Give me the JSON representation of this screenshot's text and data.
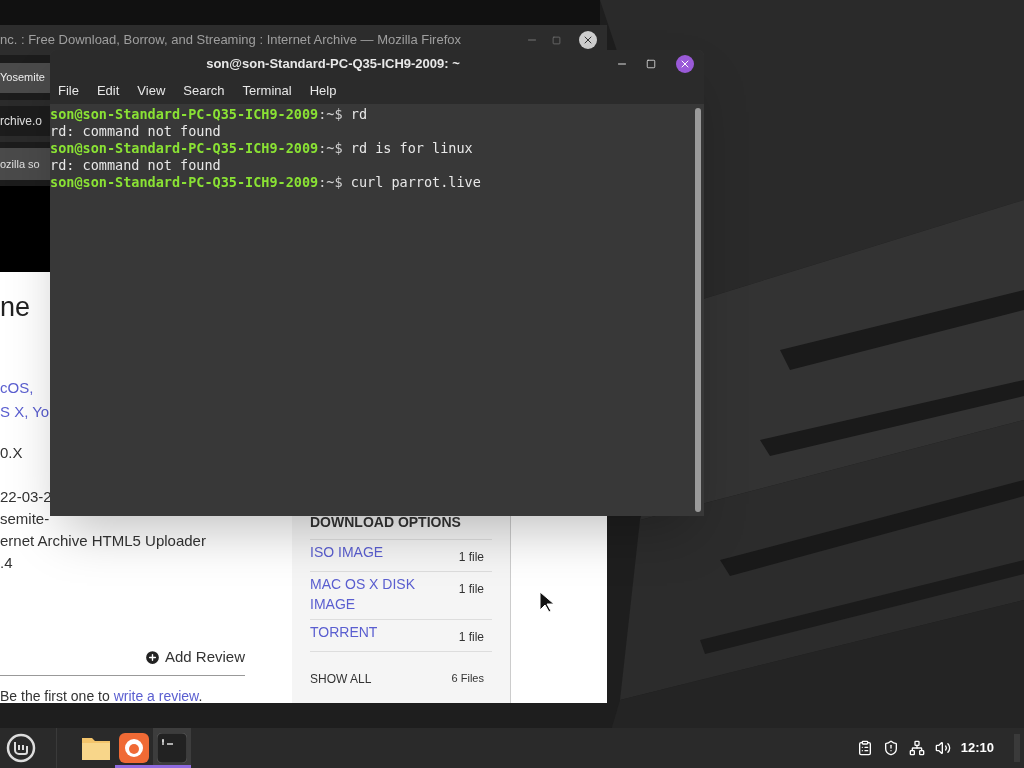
{
  "browser_window": {
    "title": "nc. : Free Download, Borrow, and Streaming : Internet Archive — Mozilla Firefox",
    "tab": "Yosemite",
    "address": "rchive.o",
    "bookmark": "ozilla so",
    "page": {
      "heading": "ne",
      "details": [
        {
          "kind": "link",
          "text": "cOS,"
        },
        {
          "kind": "link",
          "text": "S X, Yo"
        },
        {
          "kind": "text",
          "text": "0.X"
        },
        {
          "kind": "text",
          "text": "22-03-2"
        },
        {
          "kind": "text",
          "text": "semite-"
        },
        {
          "kind": "text",
          "text": "ernet Archive HTML5 Uploader"
        },
        {
          "kind": "text",
          "text": ".4"
        }
      ],
      "add_review": "Add Review",
      "review_prompt": "Be the first one to **write a review**.",
      "download_options": {
        "title": "DOWNLOAD OPTIONS",
        "items": [
          {
            "label": "ISO IMAGE",
            "count": "1 file"
          },
          {
            "label": "MAC OS X DISK IMAGE",
            "count": "1 file"
          },
          {
            "label": "TORRENT",
            "count": "1 file"
          }
        ],
        "show_all": "SHOW ALL",
        "show_all_count": "6 Files"
      }
    }
  },
  "terminal_window": {
    "title": "son@son-Standard-PC-Q35-ICH9-2009: ~",
    "menu": [
      "File",
      "Edit",
      "View",
      "Search",
      "Terminal",
      "Help"
    ],
    "lines": [
      {
        "kind": "prompt",
        "user": "son@son-Standard-PC-Q35-ICH9-2009",
        "path": ":~$",
        "command": "rd"
      },
      {
        "kind": "output",
        "text": "rd: command not found"
      },
      {
        "kind": "prompt",
        "user": "son@son-Standard-PC-Q35-ICH9-2009",
        "path": ":~$",
        "command": "rd is for linux"
      },
      {
        "kind": "output",
        "text": "rd: command not found"
      },
      {
        "kind": "prompt",
        "user": "son@son-Standard-PC-Q35-ICH9-2009",
        "path": ":~$",
        "command": "curl parrot.live"
      }
    ]
  },
  "taskbar": {
    "apps": [
      {
        "kind": "folder",
        "running": false,
        "selected": false
      },
      {
        "kind": "firefox",
        "running": true,
        "selected": false
      },
      {
        "kind": "terminal",
        "running": true,
        "selected": true
      }
    ],
    "clock": "12:10"
  }
}
